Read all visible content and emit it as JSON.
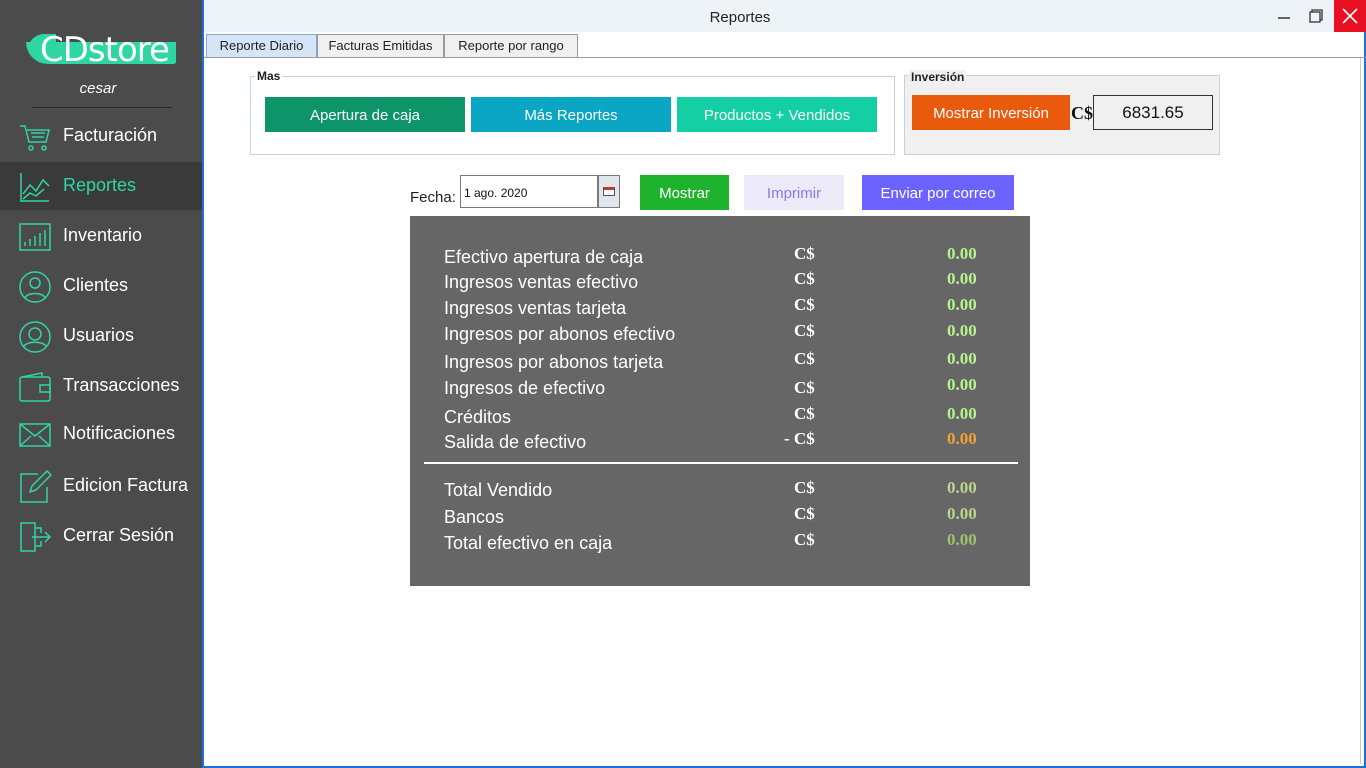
{
  "sidebar": {
    "logo": "CDstore",
    "username": "cesar",
    "items": [
      {
        "label": "Facturación",
        "icon": "cart-icon"
      },
      {
        "label": "Reportes",
        "icon": "chart-icon",
        "active": true
      },
      {
        "label": "Inventario",
        "icon": "bar-chart-icon"
      },
      {
        "label": "Clientes",
        "icon": "user-icon"
      },
      {
        "label": "Usuarios",
        "icon": "users-icon"
      },
      {
        "label": "Transacciones",
        "icon": "wallet-icon"
      },
      {
        "label": "Notificaciones",
        "icon": "mail-icon"
      },
      {
        "label": "Edicion Factura",
        "icon": "edit-icon"
      },
      {
        "label": "Cerrar Sesión",
        "icon": "logout-icon"
      }
    ]
  },
  "window": {
    "title": "Reportes",
    "tabs": [
      "Reporte Diario",
      "Facturas Emitidas",
      "Reporte por rango"
    ]
  },
  "mas": {
    "legend": "Mas",
    "buttons": [
      "Apertura de caja",
      "Más Reportes",
      "Productos + Vendidos"
    ]
  },
  "inversion": {
    "legend": "Inversión",
    "button": "Mostrar Inversión",
    "currency": "C$",
    "value": "6831.65"
  },
  "fecha": {
    "label": "Fecha:",
    "value": "1 ago. 2020"
  },
  "actions": {
    "show": "Mostrar",
    "print": "Imprimir",
    "email": "Enviar por correo"
  },
  "report": {
    "rows": [
      {
        "label": "Efectivo apertura de caja",
        "currency": "C$",
        "value": "0.00"
      },
      {
        "label": "Ingresos ventas efectivo",
        "currency": "C$",
        "value": "0.00"
      },
      {
        "label": "Ingresos ventas tarjeta",
        "currency": "C$",
        "value": "0.00"
      },
      {
        "label": "Ingresos por abonos efectivo",
        "currency": "C$",
        "value": "0.00"
      },
      {
        "label": "Ingresos por abonos tarjeta",
        "currency": "C$",
        "value": "0.00"
      },
      {
        "label": "Ingresos de efectivo",
        "currency": "C$",
        "value": "0.00"
      },
      {
        "label": "Créditos",
        "currency": "C$",
        "value": "0.00"
      },
      {
        "label": "Salida de efectivo",
        "currency": "- C$",
        "value": "0.00"
      }
    ],
    "totals": [
      {
        "label": "Total Vendido",
        "currency": "C$",
        "value": "0.00"
      },
      {
        "label": "Bancos",
        "currency": "C$",
        "value": "0.00"
      },
      {
        "label": "Total efectivo en caja",
        "currency": "C$",
        "value": "0.00"
      }
    ]
  },
  "colors": {
    "accent": "#2fd6a4",
    "value_green": "#b6f58c",
    "value_orange": "#f5a033",
    "value_olive": "#b9d68c"
  }
}
